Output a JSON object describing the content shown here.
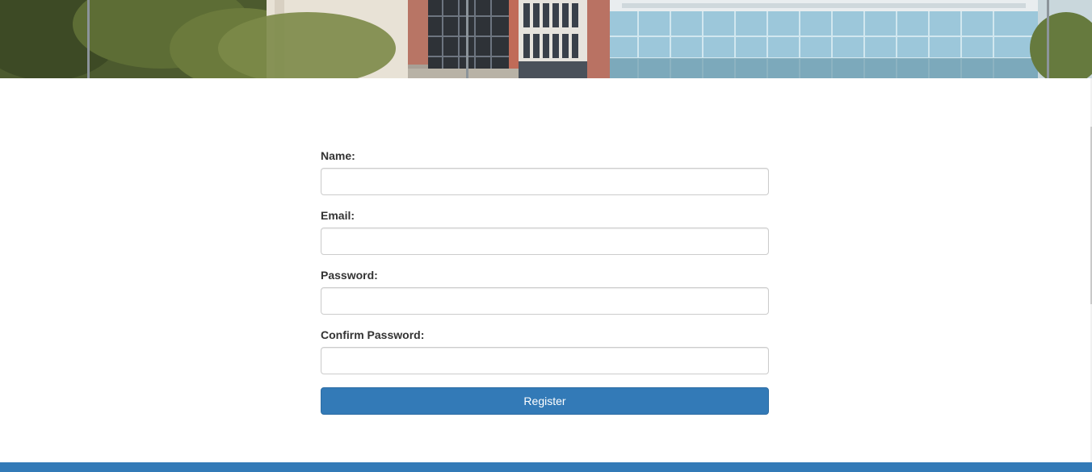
{
  "banner": {
    "alt": "campus buildings photo"
  },
  "form": {
    "name_label": "Name:",
    "email_label": "Email:",
    "password_label": "Password:",
    "confirm_password_label": "Confirm Password:",
    "name_value": "",
    "email_value": "",
    "password_value": "",
    "confirm_password_value": "",
    "register_label": "Register"
  },
  "colors": {
    "primary": "#337ab7",
    "label_text": "#333333",
    "input_border": "#cccccc"
  }
}
